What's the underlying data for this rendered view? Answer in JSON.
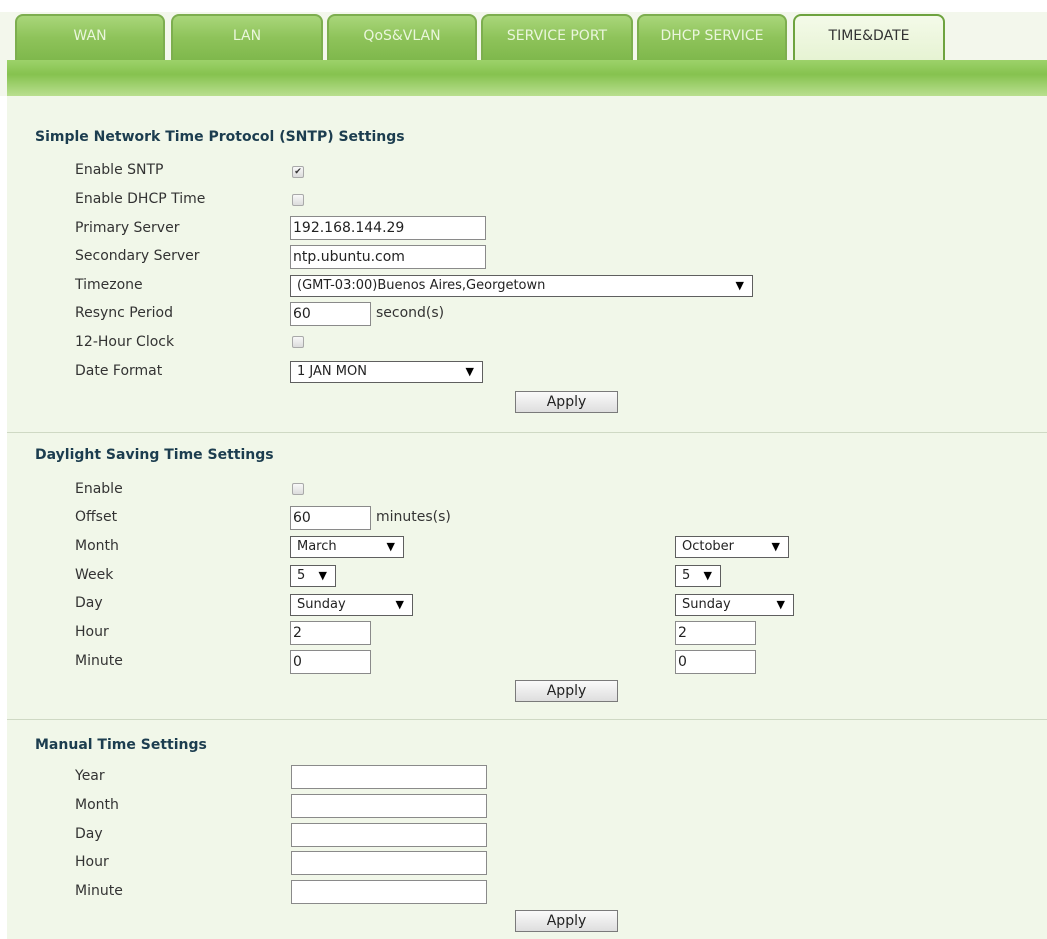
{
  "tabs": [
    {
      "label": "WAN"
    },
    {
      "label": "LAN"
    },
    {
      "label": "QoS&VLAN"
    },
    {
      "label": "SERVICE PORT"
    },
    {
      "label": "DHCP SERVICE"
    },
    {
      "label": "TIME&DATE"
    }
  ],
  "sntp": {
    "title": "Simple Network Time Protocol (SNTP) Settings",
    "enable_sntp_label": "Enable SNTP",
    "enable_sntp_checked": true,
    "enable_dhcp_label": "Enable DHCP Time",
    "enable_dhcp_checked": false,
    "primary_label": "Primary Server",
    "primary_value": "192.168.144.29",
    "secondary_label": "Secondary Server",
    "secondary_value": "ntp.ubuntu.com",
    "timezone_label": "Timezone",
    "timezone_value": "(GMT-03:00)Buenos Aires,Georgetown",
    "resync_label": "Resync Period",
    "resync_value": "60",
    "resync_unit": "second(s)",
    "clock12_label": "12-Hour Clock",
    "clock12_checked": false,
    "dateformat_label": "Date Format",
    "dateformat_value": "1 JAN MON",
    "apply": "Apply"
  },
  "dst": {
    "title": "Daylight Saving Time Settings",
    "enable_label": "Enable",
    "enable_checked": false,
    "offset_label": "Offset",
    "offset_value": "60",
    "offset_unit": "minutes(s)",
    "month_label": "Month",
    "week_label": "Week",
    "day_label": "Day",
    "hour_label": "Hour",
    "minute_label": "Minute",
    "start": {
      "month": "March",
      "week": "5",
      "day": "Sunday",
      "hour": "2",
      "minute": "0"
    },
    "end": {
      "month": "October",
      "week": "5",
      "day": "Sunday",
      "hour": "2",
      "minute": "0"
    },
    "apply": "Apply"
  },
  "manual": {
    "title": "Manual Time Settings",
    "year_label": "Year",
    "month_label": "Month",
    "day_label": "Day",
    "hour_label": "Hour",
    "minute_label": "Minute",
    "year_value": "",
    "month_value": "",
    "day_value": "",
    "hour_value": "",
    "minute_value": "",
    "apply": "Apply"
  },
  "icons": {
    "dropdown": "triangle-down-icon",
    "check": "checkmark-icon"
  },
  "colors": {
    "tab_green": "#8ec35a",
    "band_green": "#86c24f",
    "panel_bg": "#f1f7e9",
    "title_color": "#1c3d4f"
  }
}
